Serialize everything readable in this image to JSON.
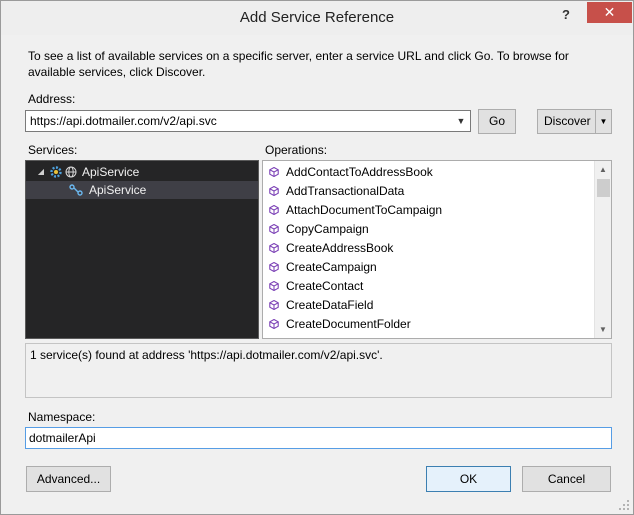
{
  "window": {
    "title": "Add Service Reference",
    "help_label": "?",
    "close_label": "✕"
  },
  "intro_text": "To see a list of available services on a specific server, enter a service URL and click Go. To browse for available services, click Discover.",
  "address": {
    "label": "Address:",
    "value": "https://api.dotmailer.com/v2/api.svc",
    "dropdown_glyph": "▼"
  },
  "buttons": {
    "go": "Go",
    "discover": "Discover",
    "advanced": "Advanced...",
    "ok": "OK",
    "cancel": "Cancel"
  },
  "services": {
    "label": "Services:",
    "items": [
      {
        "label": "ApiService",
        "icon": "globe-service-icon",
        "expanded": true
      },
      {
        "label": "ApiService",
        "icon": "contract-icon",
        "selected": true
      }
    ]
  },
  "operations": {
    "label": "Operations:",
    "items": [
      "AddContactToAddressBook",
      "AddTransactionalData",
      "AttachDocumentToCampaign",
      "CopyCampaign",
      "CreateAddressBook",
      "CreateCampaign",
      "CreateContact",
      "CreateDataField",
      "CreateDocumentFolder"
    ]
  },
  "status": "1 service(s) found at address 'https://api.dotmailer.com/v2/api.svc'.",
  "namespace": {
    "label": "Namespace:",
    "value": "dotmailerApi"
  },
  "colors": {
    "close_button": "#c7504a",
    "services_background": "#252526",
    "operation_icon": "#7a3fb5",
    "focus_border": "#569de5"
  }
}
